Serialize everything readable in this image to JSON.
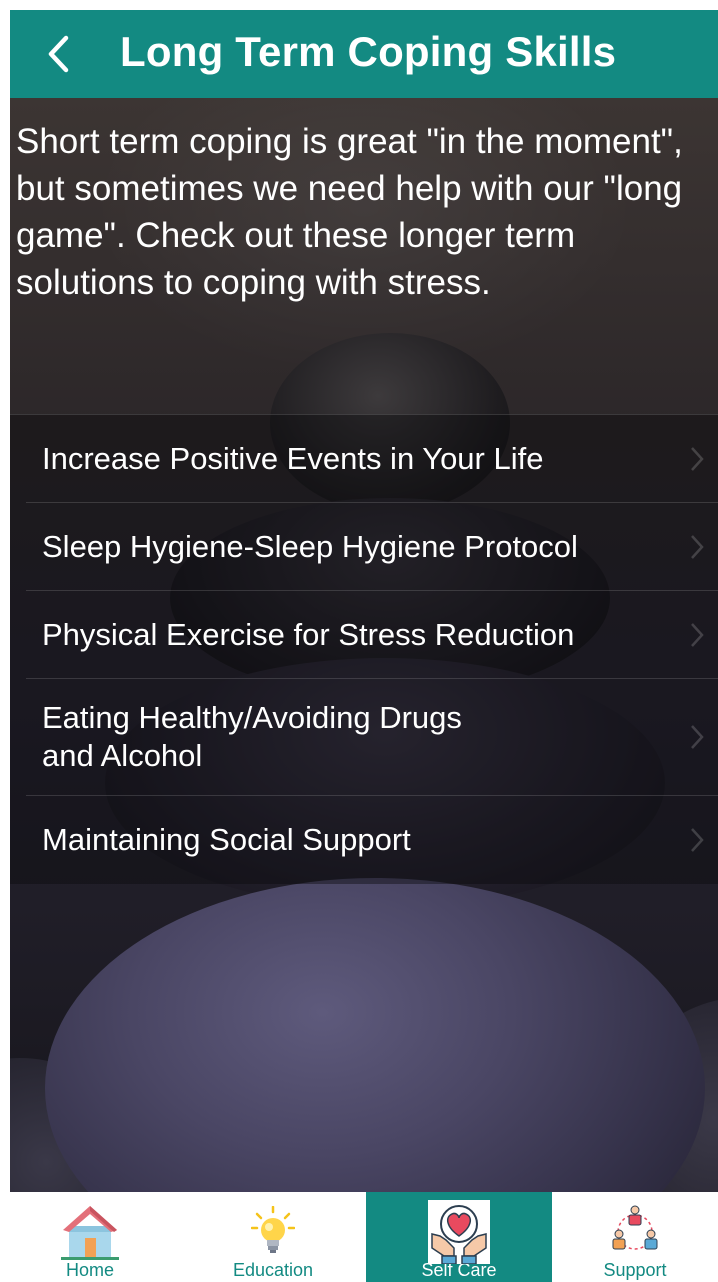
{
  "header": {
    "title": "Long Term Coping Skills",
    "back_icon": "chevron-left-icon"
  },
  "intro": {
    "text": "Short term coping is great \"in the moment\", but sometimes we need help with our \"long game\".  Check out these longer term solutions to coping with stress."
  },
  "menu": {
    "items": [
      {
        "label": "Increase Positive Events in Your Life"
      },
      {
        "label": "Sleep Hygiene-Sleep Hygiene Protocol"
      },
      {
        "label": "Physical Exercise for Stress Reduction"
      },
      {
        "label": "Eating Healthy/Avoiding Drugs\nand Alcohol"
      },
      {
        "label": "Maintaining Social Support"
      }
    ]
  },
  "tabbar": {
    "tabs": [
      {
        "label": "Home",
        "icon": "house-icon",
        "selected": false
      },
      {
        "label": "Education",
        "icon": "lightbulb-icon",
        "selected": false
      },
      {
        "label": "Self Care",
        "icon": "hands-heart-icon",
        "selected": true
      },
      {
        "label": "Support",
        "icon": "people-network-icon",
        "selected": false
      }
    ]
  },
  "colors": {
    "accent": "#138a82",
    "text_light": "#ffffff"
  }
}
